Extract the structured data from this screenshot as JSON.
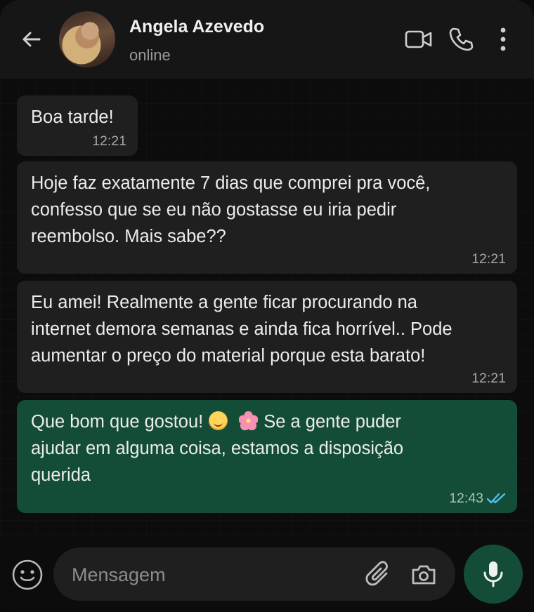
{
  "header": {
    "contact_name": "Angela Azevedo",
    "status": "online",
    "icons": [
      "back-arrow-icon",
      "video-call-icon",
      "phone-call-icon",
      "more-vertical-icon"
    ]
  },
  "messages": [
    {
      "direction": "incoming",
      "text": "Boa tarde!",
      "time": "12:21"
    },
    {
      "direction": "incoming",
      "lines": [
        "Hoje faz exatamente 7 dias que comprei pra você,",
        "confesso que se eu não gostasse eu iria pedir",
        "reembolso. Mais sabe??"
      ],
      "time": "12:21"
    },
    {
      "direction": "incoming",
      "lines": [
        "Eu amei! Realmente a gente ficar procurando na",
        "internet demora semanas e ainda fica horrível.. Pode",
        "aumentar o preço do material porque esta barato!"
      ],
      "time": "12:21"
    },
    {
      "direction": "outgoing",
      "line1_before": "Que bom que gostou!",
      "line1_after": "Se a gente puder",
      "emojis": [
        "smiling-face-emoji",
        "cherry-blossom-emoji"
      ],
      "lines_rest": [
        "ajudar em alguma coisa, estamos a disposição",
        "querida"
      ],
      "time": "12:43",
      "read_status": "read",
      "tick_color": "#53bdeb"
    }
  ],
  "input": {
    "placeholder": "Mensagem"
  },
  "colors": {
    "outgoing_bubble": "#144d37",
    "incoming_bubble": "#1f1f1f",
    "accent": "#144d37"
  }
}
